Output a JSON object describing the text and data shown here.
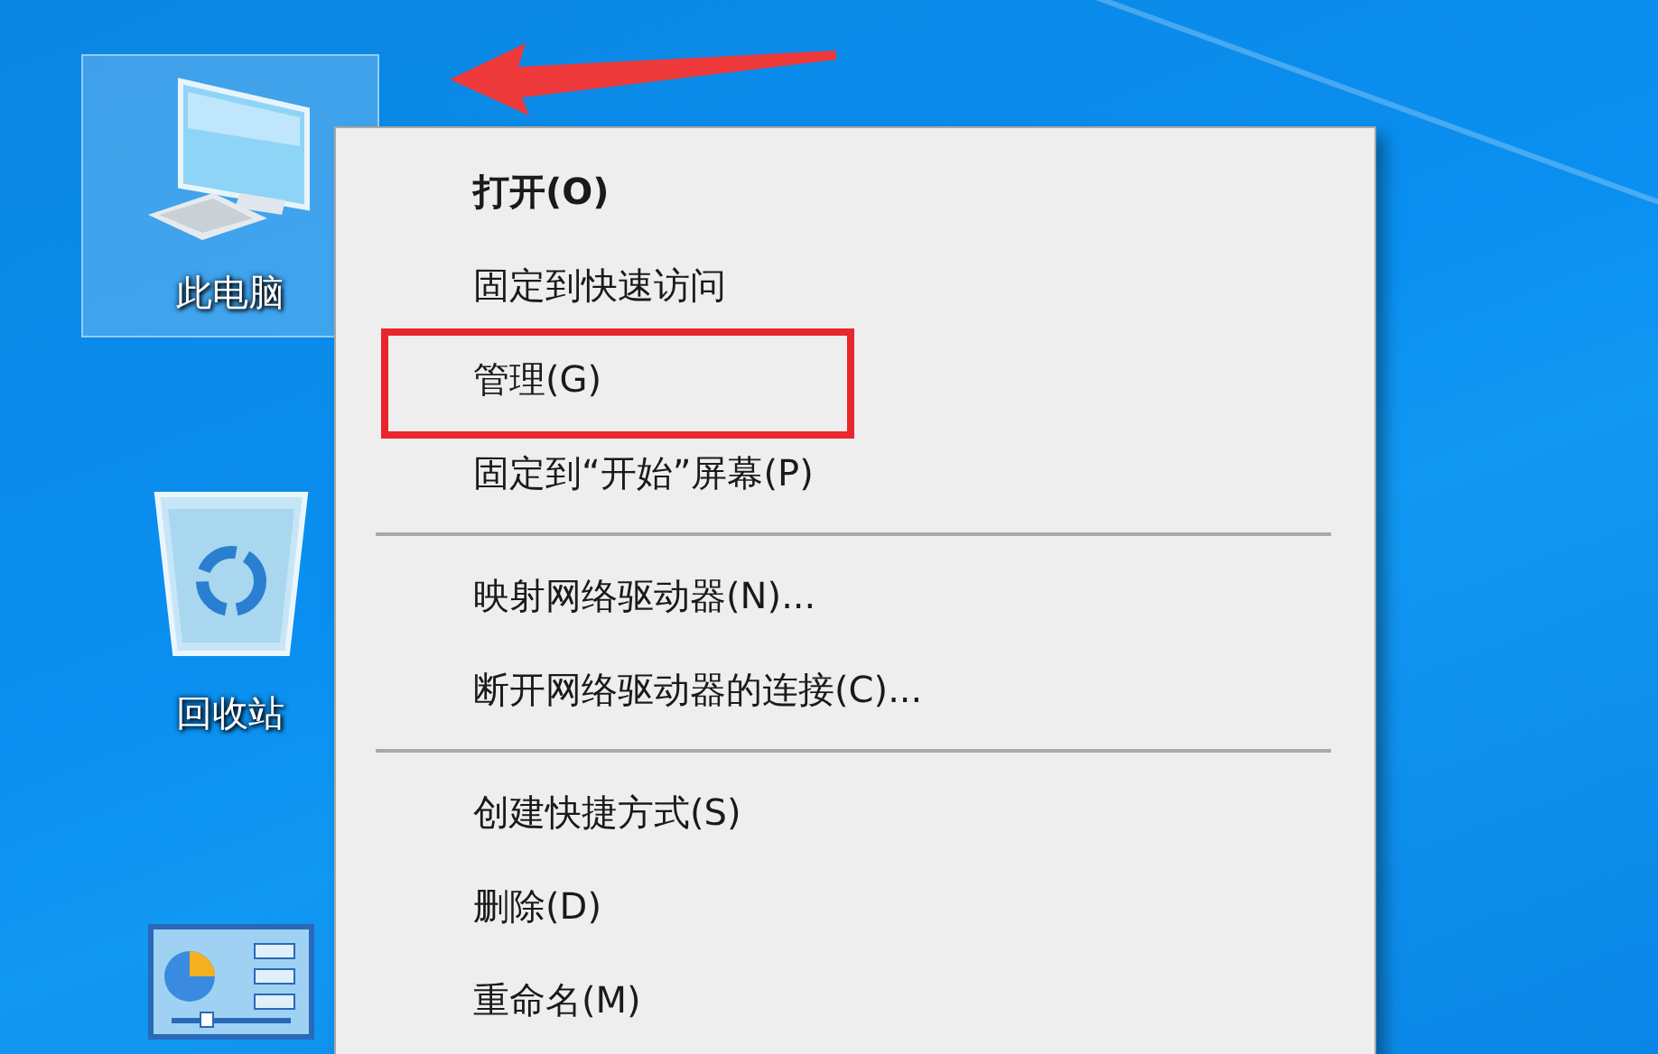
{
  "desktop_icons": [
    {
      "kind": "computer",
      "label": "此电脑",
      "selected": true,
      "arrow": true
    },
    {
      "kind": "recycle_bin",
      "label": "回收站",
      "selected": false,
      "arrow": false
    },
    {
      "kind": "control_panel",
      "selected": false,
      "arrow": false
    }
  ],
  "context_menu": {
    "items": [
      {
        "kind": "item",
        "label": "打开(O)",
        "default": true,
        "highlighted": false
      },
      {
        "kind": "item",
        "label": "固定到快速访问",
        "default": false,
        "highlighted": false
      },
      {
        "kind": "item",
        "label": "管理(G)",
        "default": false,
        "highlighted": true
      },
      {
        "kind": "item",
        "label": "固定到“开始”屏幕(P)",
        "default": false,
        "highlighted": false
      },
      {
        "kind": "separator"
      },
      {
        "kind": "item",
        "label": "映射网络驱动器(N)...",
        "default": false,
        "highlighted": false
      },
      {
        "kind": "item",
        "label": "断开网络驱动器的连接(C)...",
        "default": false,
        "highlighted": false
      },
      {
        "kind": "separator"
      },
      {
        "kind": "item",
        "label": "创建快捷方式(S)",
        "default": false,
        "highlighted": false
      },
      {
        "kind": "item",
        "label": "删除(D)",
        "default": false,
        "highlighted": false
      },
      {
        "kind": "item",
        "label": "重命名(M)",
        "default": false,
        "highlighted": false
      }
    ]
  }
}
